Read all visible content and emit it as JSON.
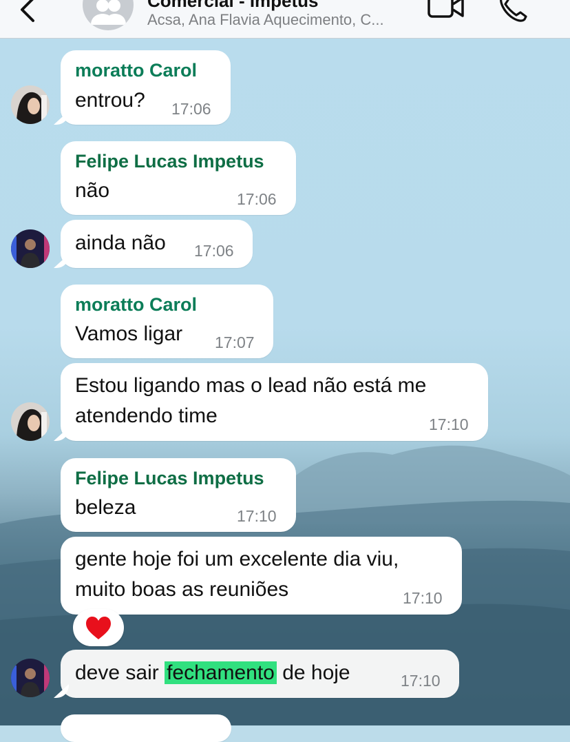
{
  "header": {
    "title": "Comercial - Impetus",
    "subtitle": "Acsa, Ana Flavia Aquecimento, C..."
  },
  "messages": [
    {
      "sender": "moratto Carol",
      "text": "entrou?",
      "time": "17:06"
    },
    {
      "sender": "Felipe Lucas Impetus",
      "text": "não",
      "time": "17:06"
    },
    {
      "text": "ainda não",
      "time": "17:06"
    },
    {
      "sender": "moratto Carol",
      "text": "Vamos ligar",
      "time": "17:07"
    },
    {
      "text_line1": "Estou ligando mas o lead não está me",
      "text_line2": "atendendo time",
      "time": "17:10"
    },
    {
      "sender": "Felipe Lucas Impetus",
      "text": "beleza",
      "time": "17:10"
    },
    {
      "text_line1": "gente hoje foi um excelente dia viu,",
      "text_line2": "muito boas as reuniões",
      "time": "17:10",
      "reaction": "❤️"
    },
    {
      "text_before": "deve sair ",
      "highlight": "fechamento",
      "text_after": " de hoje",
      "time": "17:10"
    }
  ],
  "colors": {
    "carol_name": "#0c7d58",
    "felipe_name": "#0f6e45",
    "search_highlight": "#31e07f"
  }
}
